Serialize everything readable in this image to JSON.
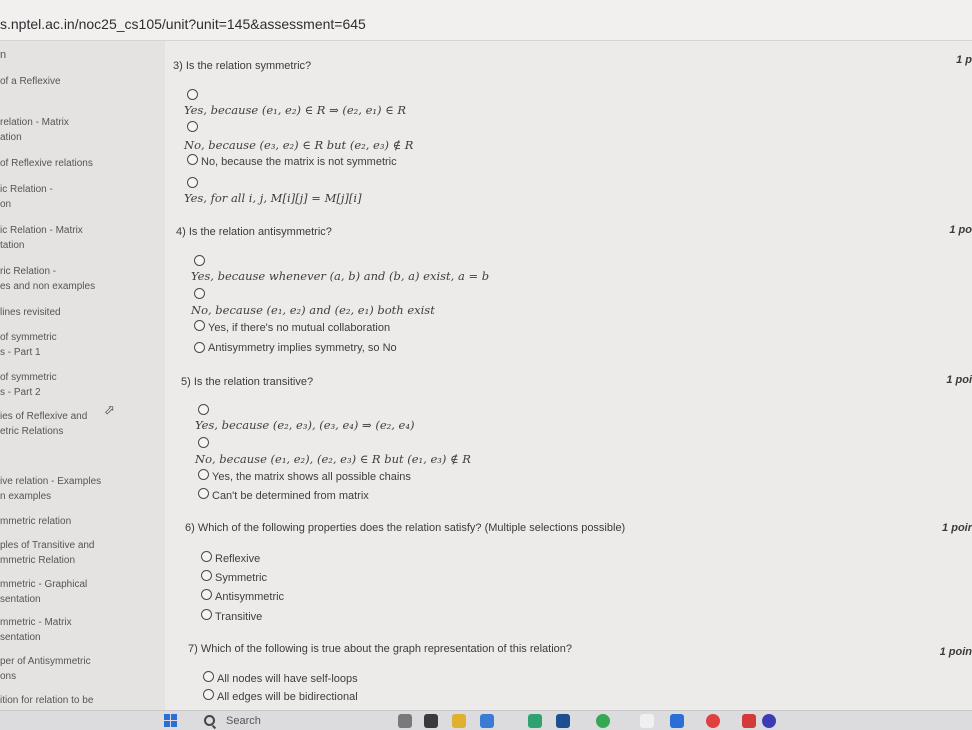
{
  "browser": {
    "url": "s.nptel.ac.in/noc25_cs105/unit?unit=145&assessment=645"
  },
  "sidebar": {
    "top_char": "n",
    "items": [
      {
        "lines": [
          "of a Reflexive"
        ]
      },
      {
        "lines": [
          "relation - Matrix",
          "ation"
        ]
      },
      {
        "lines": [
          "of Reflexive relations"
        ]
      },
      {
        "lines": [
          "ic Relation -",
          "on"
        ]
      },
      {
        "lines": [
          "ic Relation - Matrix",
          "tation"
        ]
      },
      {
        "lines": [
          "ric Relation -",
          "es and non examples"
        ]
      },
      {
        "lines": [
          "lines revisited"
        ]
      },
      {
        "lines": [
          "of symmetric",
          "s - Part 1"
        ]
      },
      {
        "lines": [
          "of symmetric",
          "s - Part 2"
        ]
      },
      {
        "lines": [
          "ies of Reflexive and",
          "etric Relations"
        ]
      },
      {
        "lines": [
          "ive relation - Examples",
          "n examples"
        ]
      },
      {
        "lines": [
          "mmetric relation"
        ]
      },
      {
        "lines": [
          "ples of Transitive and",
          "mmetric Relation"
        ]
      },
      {
        "lines": [
          "mmetric - Graphical",
          "sentation"
        ]
      },
      {
        "lines": [
          "mmetric - Matrix",
          "sentation"
        ]
      },
      {
        "lines": [
          "per of Antisymmetric",
          "ons"
        ]
      },
      {
        "lines": [
          "ition for relation to be"
        ]
      }
    ]
  },
  "questions": [
    {
      "number": "3)",
      "text": "Is the relation symmetric?",
      "points": "1 p",
      "options": [
        {
          "text": "Yes, because (e₁, e₂) ∈ R ⇒ (e₂, e₁) ∈ R",
          "math": true
        },
        {
          "text": "No, because (e₃, e₂) ∈ R but (e₂, e₃) ∉ R",
          "math": true
        },
        {
          "text": "No, because the matrix is not symmetric",
          "math": false
        },
        {
          "text": "Yes, for all i, j, M[i][j] = M[j][i]",
          "math": true
        }
      ]
    },
    {
      "number": "4)",
      "text": "Is the relation antisymmetric?",
      "points": "1 po",
      "options": [
        {
          "text": "Yes, because whenever (a, b) and (b, a) exist, a = b",
          "math": true
        },
        {
          "text": "No, because (e₁, e₂) and (e₂, e₁) both exist",
          "math": true
        },
        {
          "text": "Yes, if there's no mutual collaboration",
          "math": false
        },
        {
          "text": "Antisymmetry implies symmetry, so No",
          "math": false
        }
      ]
    },
    {
      "number": "5)",
      "text": "Is the relation transitive?",
      "points": "1 poi",
      "options": [
        {
          "text": "Yes, because (e₂, e₃), (e₃, e₄) ⇒ (e₂, e₄)",
          "math": true
        },
        {
          "text": "No, because (e₁, e₂), (e₂, e₃) ∈ R but (e₁, e₃) ∉ R",
          "math": true
        },
        {
          "text": "Yes, the matrix shows all possible chains",
          "math": false
        },
        {
          "text": "Can't be determined from matrix",
          "math": false
        }
      ]
    },
    {
      "number": "6)",
      "text": "Which of the following properties does the relation satisfy? (Multiple selections possible)",
      "points": "1 poir",
      "options": [
        {
          "text": "Reflexive",
          "math": false
        },
        {
          "text": "Symmetric",
          "math": false
        },
        {
          "text": "Antisymmetric",
          "math": false
        },
        {
          "text": "Transitive",
          "math": false
        }
      ]
    },
    {
      "number": "7)",
      "text": "Which of the following is true about the graph representation of this relation?",
      "points": "1 poin",
      "options": [
        {
          "text": "All nodes will have self-loops",
          "math": false
        },
        {
          "text": "All edges will be bidirectional",
          "math": false
        }
      ]
    }
  ],
  "taskbar": {
    "search_label": "Search",
    "icons": [
      "windows-icon",
      "search-icon",
      "widget-icon",
      "file-icon",
      "folder-icon",
      "store-icon",
      "edge-icon",
      "dell-icon",
      "chrome-icon",
      "document-icon",
      "app-icon",
      "opera-icon",
      "red-app-icon",
      "avatar-icon"
    ],
    "icon_colors": [
      "#2b6fd6",
      "#555555",
      "#7a7a7a",
      "#3a3a3a",
      "#e0b030",
      "#3a7bd5",
      "#2fa26f",
      "#1d4f91",
      "#34a853",
      "#f0f0f0",
      "#2b6fd6",
      "#e04040",
      "#d43a3a",
      "#3b3bb3"
    ]
  }
}
